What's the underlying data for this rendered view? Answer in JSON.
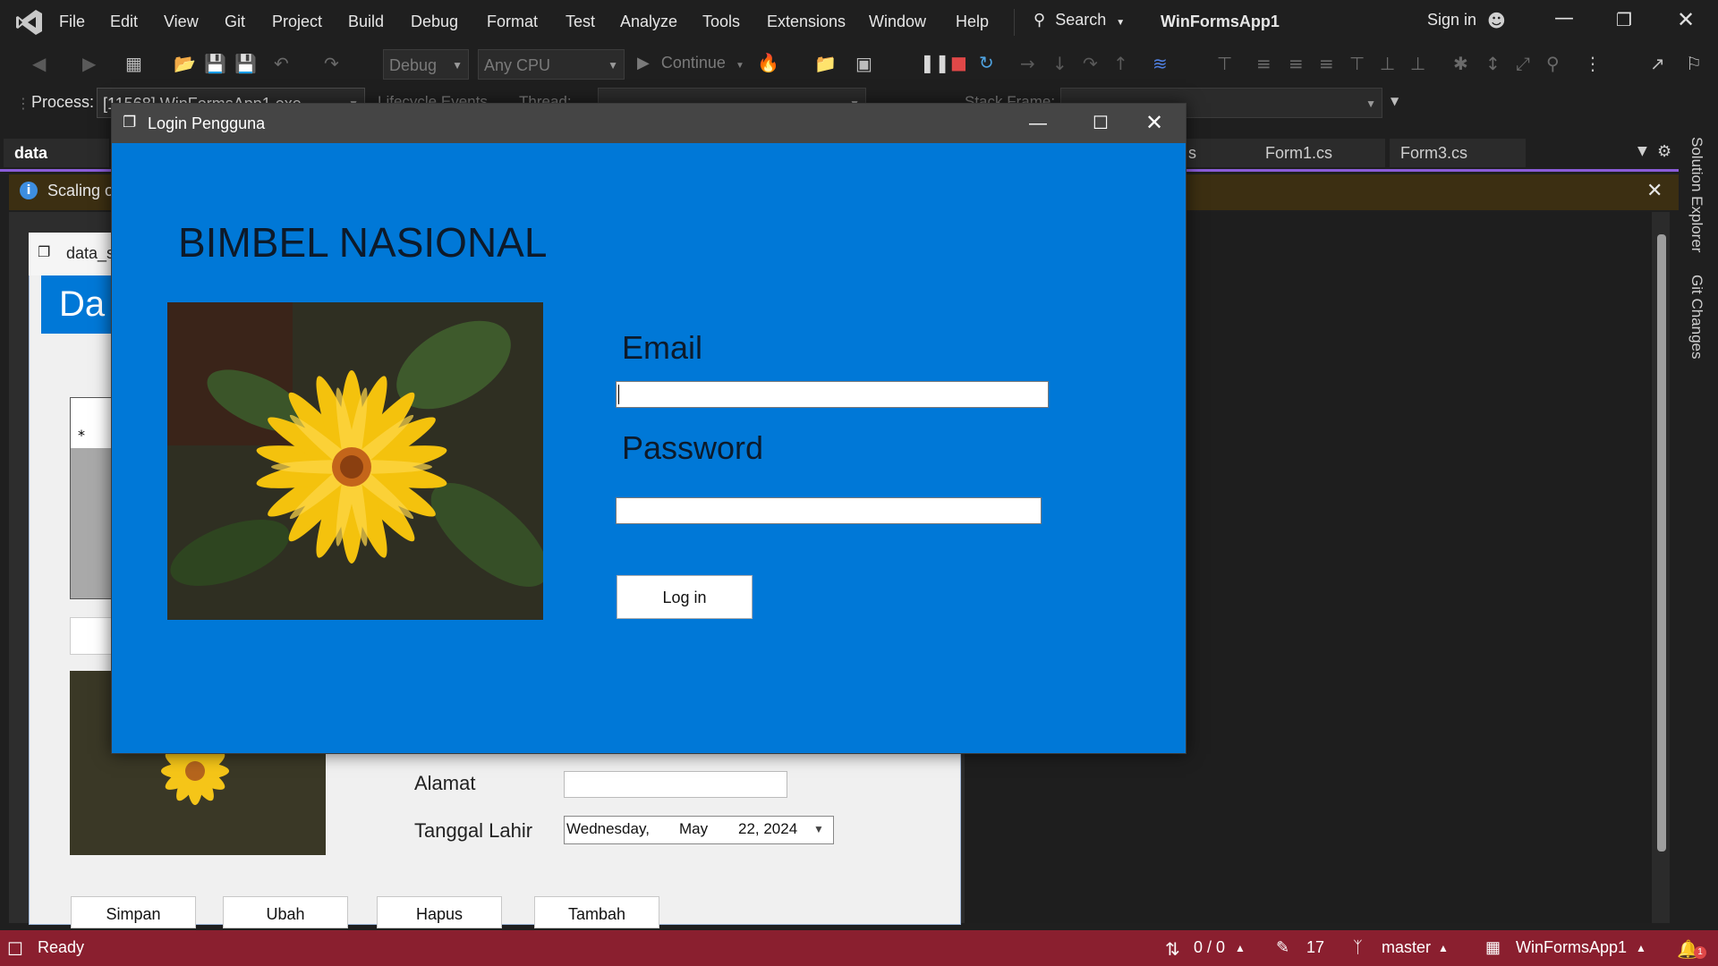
{
  "menubar": {
    "items": [
      "File",
      "Edit",
      "View",
      "Git",
      "Project",
      "Build",
      "Debug",
      "Format",
      "Test",
      "Analyze",
      "Tools",
      "Extensions",
      "Window",
      "Help"
    ],
    "search_label": "Search",
    "solution_name": "WinFormsApp1",
    "sign_in": "Sign in"
  },
  "toolbar": {
    "config": "Debug",
    "platform": "Any CPU",
    "continue_label": "Continue",
    "process_label": "Process:",
    "process_value": "[11568] WinFormsApp1.exe",
    "lifecycle_label": "Lifecycle Events",
    "thread_label": "Thread:",
    "stack_frame_label": "Stack Frame:"
  },
  "tabs": {
    "active": "data siswa.cs",
    "partial": "s",
    "form1": "Form1.cs",
    "form3": "Form3.cs"
  },
  "infobar": {
    "text": "Scaling o"
  },
  "designer": {
    "form_title": "data_s",
    "header_partial": "Da",
    "alamat_label": "Alamat",
    "tanggal_label": "Tanggal Lahir",
    "date_day": "Wednesday,",
    "date_month": "May",
    "date_rest": "22, 2024",
    "buttons": [
      "Simpan",
      "Ubah",
      "Hapus",
      "Tambah"
    ],
    "row_marker": "*",
    "partial_button": "U"
  },
  "right_rail": {
    "solution_explorer": "Solution Explorer",
    "git_changes": "Git Changes"
  },
  "statusbar": {
    "ready": "Ready",
    "sync": "0 / 0",
    "edits": "17",
    "branch": "master",
    "repo": "WinFormsApp1",
    "notifications": "1"
  },
  "dialog": {
    "title": "Login Pengguna",
    "heading": "BIMBEL NASIONAL",
    "email_label": "Email",
    "email_value": "",
    "password_label": "Password",
    "password_value": "",
    "login_button": "Log in"
  },
  "colors": {
    "dialog_bg": "#0078d7",
    "statusbar_bg": "#8a1f2f",
    "accent_tab": "#8a5cd8"
  }
}
